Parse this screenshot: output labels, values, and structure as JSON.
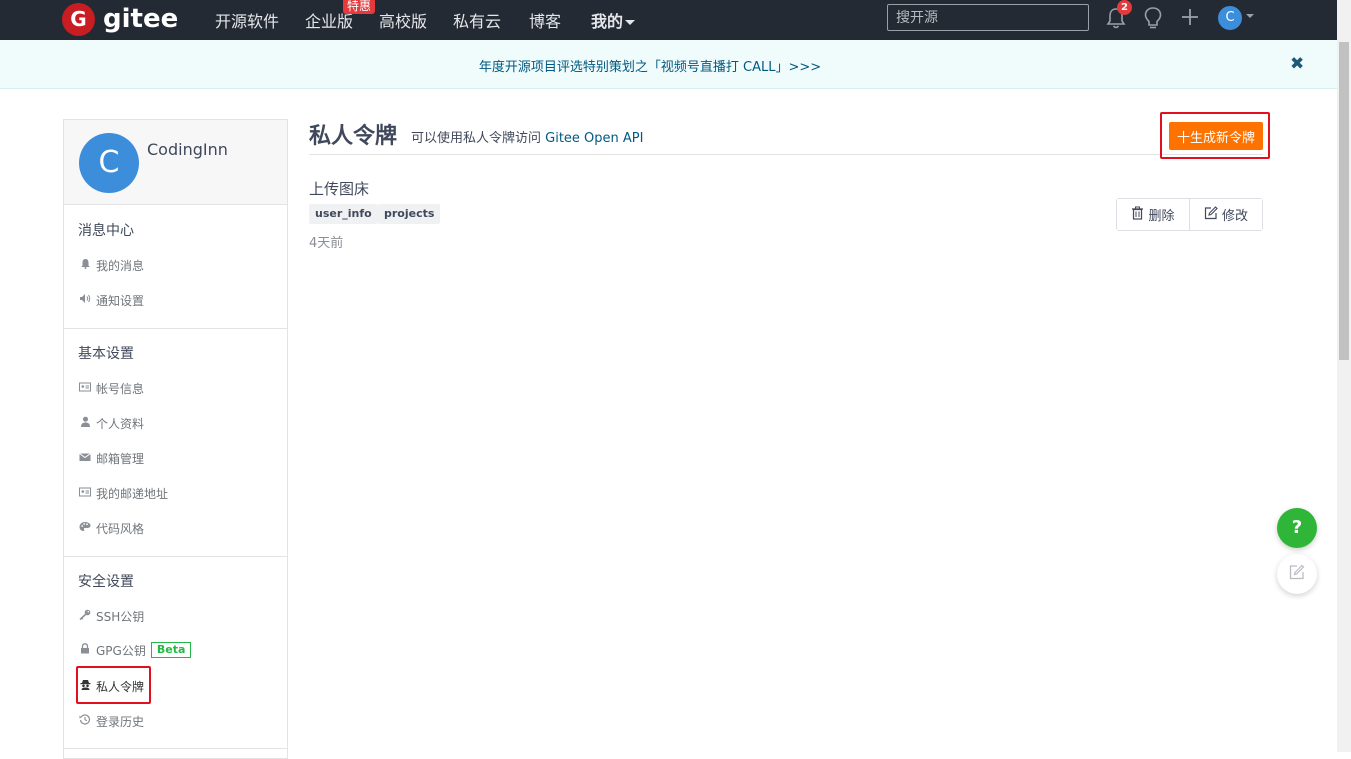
{
  "brand": {
    "logo_letter": "G",
    "name": "gitee",
    "color": "#c71d23"
  },
  "nav": {
    "items": [
      "开源软件",
      "企业版",
      "高校版",
      "私有云",
      "博客",
      "我的"
    ],
    "enterprise_badge": "特惠"
  },
  "search": {
    "placeholder": "搜开源"
  },
  "notifications": {
    "count": "2"
  },
  "user_initial": "C",
  "banner": {
    "text": "年度开源项目评选特别策划之「视频号直播打 CALL」>>>",
    "close": "✖"
  },
  "sidebar": {
    "profile": {
      "initial": "C",
      "name": "CodingInn"
    },
    "sections": [
      {
        "title": "消息中心",
        "items": [
          {
            "label": "我的消息",
            "icon": "bell-icon"
          },
          {
            "label": "通知设置",
            "icon": "speaker-icon"
          }
        ]
      },
      {
        "title": "基本设置",
        "items": [
          {
            "label": "帐号信息",
            "icon": "id-card-icon"
          },
          {
            "label": "个人资料",
            "icon": "user-icon"
          },
          {
            "label": "邮箱管理",
            "icon": "envelope-icon"
          },
          {
            "label": "我的邮递地址",
            "icon": "address-card-icon"
          },
          {
            "label": "代码风格",
            "icon": "palette-icon"
          }
        ]
      },
      {
        "title": "安全设置",
        "items": [
          {
            "label": "SSH公钥",
            "icon": "key-icon"
          },
          {
            "label": "GPG公钥",
            "icon": "lock-icon",
            "badge": "Beta"
          },
          {
            "label": "私人令牌",
            "icon": "spy-icon"
          },
          {
            "label": "登录历史",
            "icon": "history-icon"
          }
        ]
      }
    ]
  },
  "main": {
    "title": "私人令牌",
    "subtitle_prefix": "可以使用私人令牌访问 ",
    "subtitle_api": "Gitee Open API",
    "new_token_label": "十生成新令牌",
    "token": {
      "name": "上传图床",
      "scopes": [
        "user_info",
        "projects"
      ],
      "time": "4天前",
      "delete_label": "删除",
      "edit_label": "修改"
    }
  },
  "float": {
    "help": "?"
  },
  "colors": {
    "accent": "#fe7300",
    "link": "#005980",
    "topbar": "#232a33",
    "help": "#2fb638",
    "highlight": "#e0101f"
  }
}
